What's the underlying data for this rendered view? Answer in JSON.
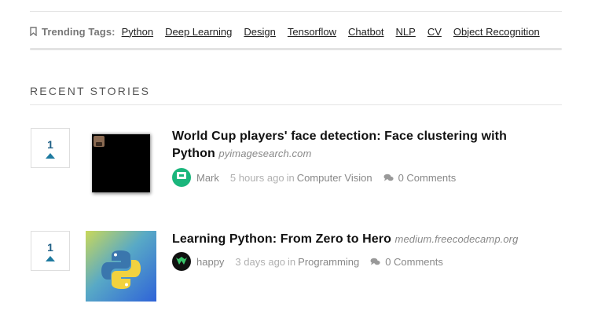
{
  "trending": {
    "label": "Trending Tags:",
    "tags": [
      "Python",
      "Deep Learning",
      "Design",
      "Tensorflow",
      "Chatbot",
      "NLP",
      "CV",
      "Object Recognition"
    ]
  },
  "section": {
    "title": "RECENT STORIES"
  },
  "stories": [
    {
      "votes": "1",
      "title": "World Cup players' face detection: Face clustering with Python",
      "domain": "pyimagesearch.com",
      "author": "Mark",
      "time": "5 hours ago",
      "in_word": "in",
      "category": "Computer Vision",
      "comments": "0 Comments"
    },
    {
      "votes": "1",
      "title": "Learning Python: From Zero to Hero",
      "domain": "medium.freecodecamp.org",
      "author": "happy",
      "time": "3 days ago",
      "in_word": "in",
      "category": "Programming",
      "comments": "0 Comments"
    }
  ],
  "colors": {
    "vote": "#1e5f86",
    "avatar1": "#1ab67c",
    "python_blue": "#3a76ad",
    "python_yellow": "#f2d23f"
  },
  "icons": [
    "bookmark-icon",
    "upvote-arrow-icon",
    "comment-icon",
    "avatar-icon",
    "python-logo-icon"
  ]
}
